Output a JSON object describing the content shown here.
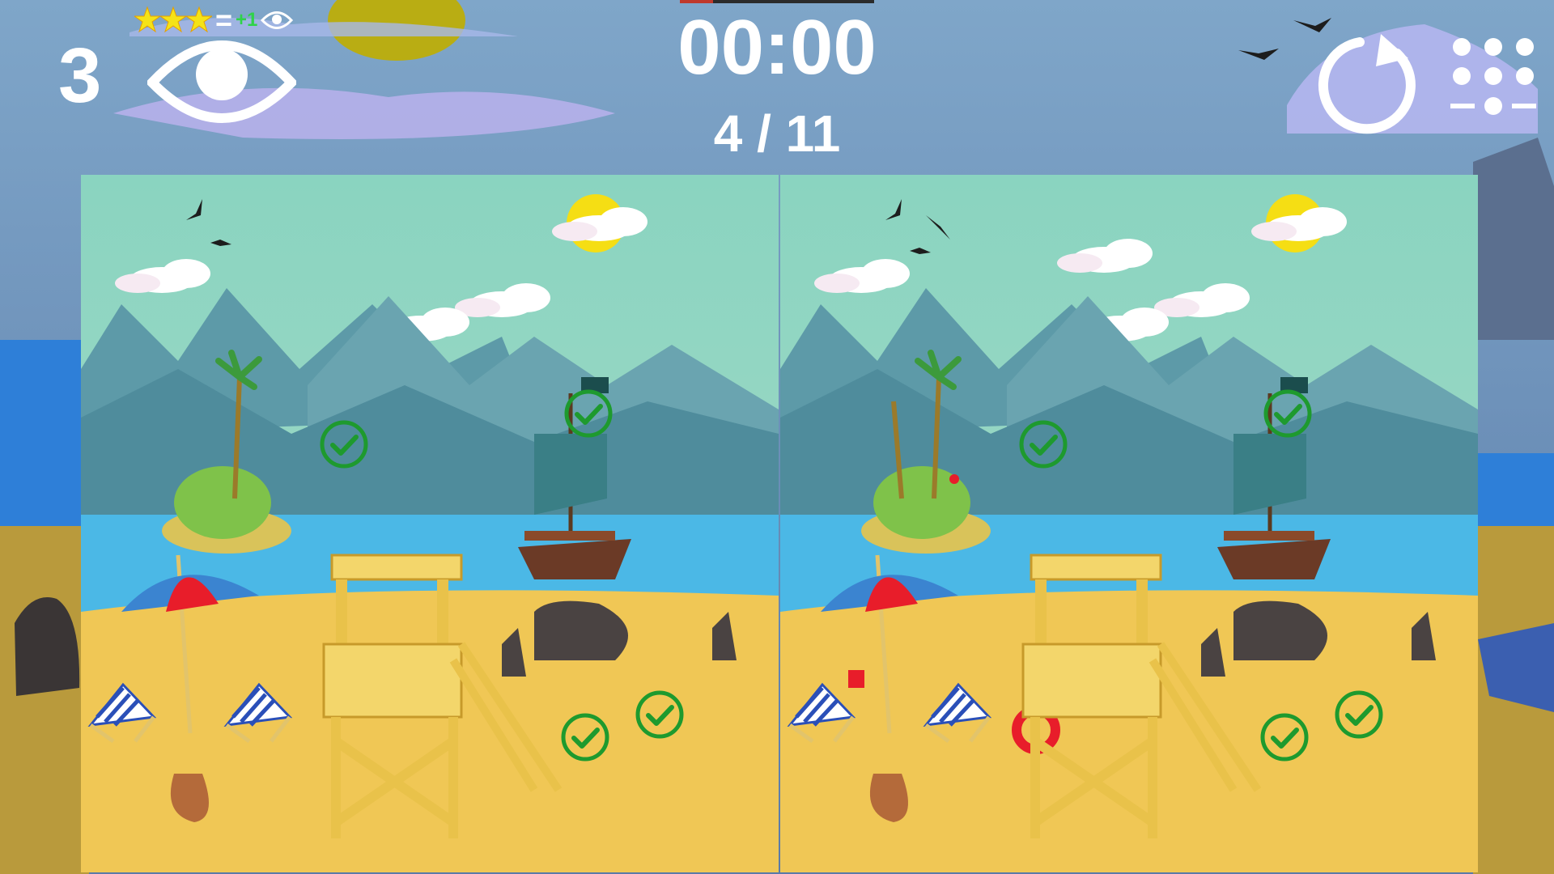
{
  "hud": {
    "hints_remaining": "3",
    "hint_offer_plus": "+1",
    "hint_offer_equals": "=",
    "timer": "00:00",
    "timer_progress": 0.17,
    "progress": "4 / 11"
  },
  "game": {
    "differences_found": 4,
    "differences_total": 11,
    "stars_for_hint": 3
  },
  "colors": {
    "found_marker": "#1e9a2e",
    "sky_top": "#8ad4c0",
    "sea": "#4bb8e6",
    "sand": "#f0c755",
    "sun": "#f5de14"
  },
  "icons": {
    "hint": "eye-icon",
    "restart": "restart-arrow-icon",
    "menu": "grid-menu-icon",
    "found": "checkmark-circle-icon"
  }
}
